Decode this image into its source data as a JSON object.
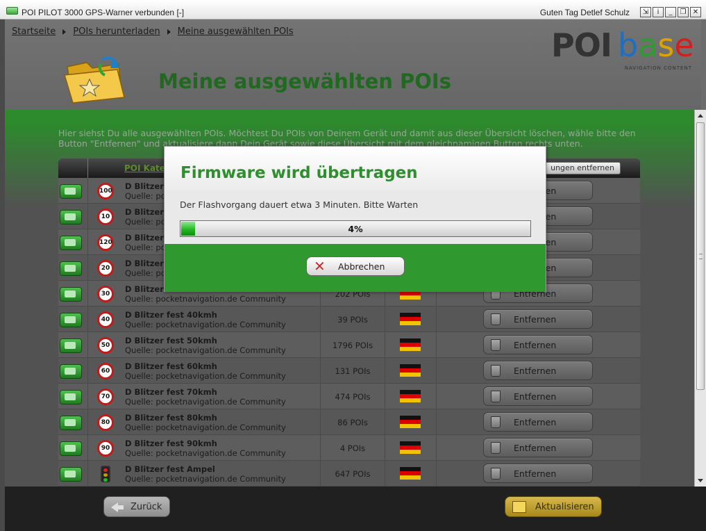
{
  "window": {
    "title": "POI PILOT 3000 GPS-Warner verbunden [-]",
    "greeting": "Guten Tag Detlef Schulz",
    "buttons": [
      "⇲",
      "i",
      "_",
      "❐",
      "✕"
    ]
  },
  "breadcrumb": [
    "Startseite",
    "POIs herunterladen",
    "Meine ausgewählten POIs"
  ],
  "logo": {
    "poi": "POI",
    "base": [
      "b",
      "a",
      "s",
      "e"
    ],
    "tagline": "NAVIGATION CONTENT"
  },
  "page_title": "Meine ausgewählten POIs",
  "intro_text": "Hier siehst Du alle ausgewählten POIs. Möchtest Du POIs von Deinem Gerät und damit aus dieser Übersicht löschen, wähle bitte den Button \"Entfernen\" und aktualisiere dann Dein Gerät sowie diese Übersicht mit dem gleichnamigen Button rechts unten.",
  "table": {
    "header_category": "POI Kate",
    "header_remove_all": "ungen entfernen",
    "remove_label": "Entfernen",
    "rows": [
      {
        "sign": "100",
        "name": "D Blitzer",
        "source": "Quelle: poc",
        "count": "",
        "flag": true
      },
      {
        "sign": "10",
        "name": "D Blitzer",
        "source": "Quelle: poc",
        "count": "",
        "flag": true
      },
      {
        "sign": "120",
        "name": "D Blitzer",
        "source": "Quelle: poc",
        "count": "",
        "flag": true
      },
      {
        "sign": "20",
        "name": "D Blitzer",
        "source": "Quelle: poc",
        "count": "",
        "flag": true
      },
      {
        "sign": "30",
        "name": "D Blitzer",
        "source": "Quelle: pocketnavigation.de Community",
        "count": "202 POIs",
        "flag": true
      },
      {
        "sign": "40",
        "name": "D Blitzer fest 40kmh",
        "source": "Quelle: pocketnavigation.de Community",
        "count": "39 POIs",
        "flag": true
      },
      {
        "sign": "50",
        "name": "D Blitzer fest 50kmh",
        "source": "Quelle: pocketnavigation.de Community",
        "count": "1796 POIs",
        "flag": true
      },
      {
        "sign": "60",
        "name": "D Blitzer fest 60kmh",
        "source": "Quelle: pocketnavigation.de Community",
        "count": "131 POIs",
        "flag": true
      },
      {
        "sign": "70",
        "name": "D Blitzer fest 70kmh",
        "source": "Quelle: pocketnavigation.de Community",
        "count": "474 POIs",
        "flag": true
      },
      {
        "sign": "80",
        "name": "D Blitzer fest 80kmh",
        "source": "Quelle: pocketnavigation.de Community",
        "count": "86 POIs",
        "flag": true
      },
      {
        "sign": "90",
        "name": "D Blitzer fest 90kmh",
        "source": "Quelle: pocketnavigation.de Community",
        "count": "4 POIs",
        "flag": true
      },
      {
        "sign": "",
        "name": "D Blitzer fest Ampel",
        "source": "Quelle: pocketnavigation.de Community",
        "count": "647 POIs",
        "flag": true,
        "traffic_light": true
      }
    ]
  },
  "footer": {
    "back_label": "Zurück",
    "update_label": "Aktualisieren"
  },
  "modal": {
    "title": "Firmware wird übertragen",
    "message": "Der Flashvorgang dauert etwa 3 Minuten. Bitte Warten",
    "progress_percent": 4,
    "progress_text": "4%",
    "cancel_label": "Abbrechen"
  },
  "colors": {
    "accent_green": "#2f8f2f",
    "title_green": "#1f6a1f",
    "update_gold": "#d8b84a",
    "speed_sign_red": "#c21a1a"
  }
}
